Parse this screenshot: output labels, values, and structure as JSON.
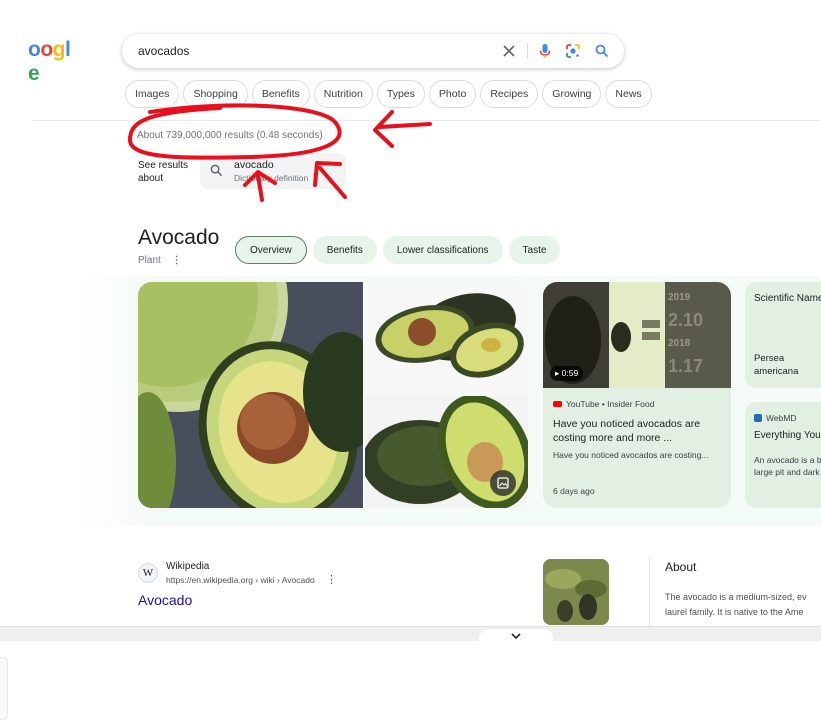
{
  "search": {
    "query": "avocados",
    "logo_text": "oogle"
  },
  "chips": [
    "Images",
    "Shopping",
    "Benefits",
    "Nutrition",
    "Types",
    "Photo",
    "Recipes",
    "Growing",
    "News"
  ],
  "result_stats": "About 739,000,000 results (0.48 seconds)",
  "spelling": {
    "see_results_label": "See results about",
    "term": "avocado",
    "subtitle": "Dictionary definition"
  },
  "knowledge_panel": {
    "title": "Avocado",
    "subtitle": "Plant",
    "tabs": [
      "Overview",
      "Benefits",
      "Lower classifications",
      "Taste"
    ]
  },
  "video": {
    "duration": "0:59",
    "source": "YouTube • Insider Food",
    "title": "Have you noticed avocados are costing more and more ...",
    "snippet": "Have you noticed avocados are costing...",
    "date": "6 days ago",
    "thumb_labels": [
      "2019",
      "2.10",
      "2018",
      "1.17"
    ]
  },
  "scientific": {
    "heading": "Scientific Name",
    "value": "Persea americana"
  },
  "webmd": {
    "source": "WebMD",
    "title": "Everything You",
    "snippet_line1": "An avocado is a b",
    "snippet_line2": "large pit and dark"
  },
  "wikipedia": {
    "name": "Wikipedia",
    "url": "https://en.wikipedia.org › wiki › Avocado",
    "title": "Avocado",
    "icon_letter": "W"
  },
  "about": {
    "heading": "About",
    "line1": "The avocado is a medium-sized, ev",
    "line2": "laurel family. It is native to the Ame"
  },
  "colors": {
    "accent_green": "#e6f4ea",
    "link_blue": "#1a0dab",
    "annotation_red": "#e8101c"
  }
}
